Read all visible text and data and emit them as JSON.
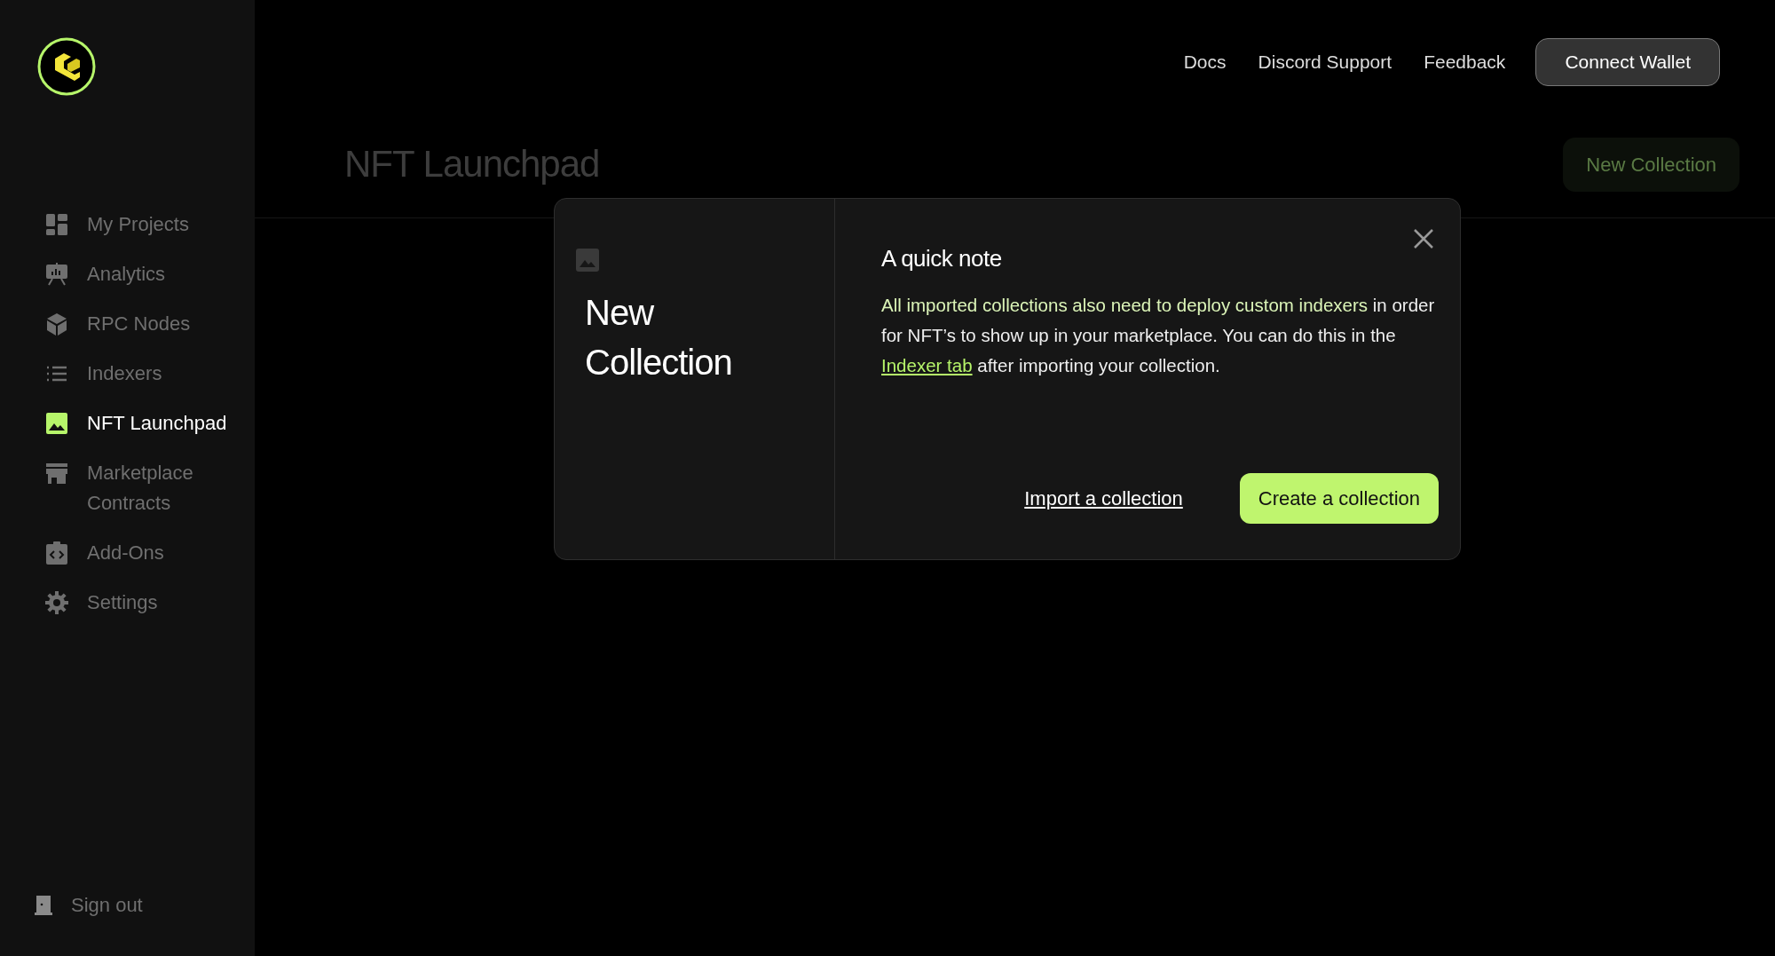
{
  "sidebar": {
    "items": [
      {
        "label": "My Projects",
        "selected": false
      },
      {
        "label": "Analytics",
        "selected": false
      },
      {
        "label": "RPC Nodes",
        "selected": false
      },
      {
        "label": "Indexers",
        "selected": false
      },
      {
        "label": "NFT Launchpad",
        "selected": true
      },
      {
        "label": "Marketplace Contracts",
        "selected": false
      },
      {
        "label": "Add-Ons",
        "selected": false
      },
      {
        "label": "Settings",
        "selected": false
      }
    ],
    "sign_out": "Sign out"
  },
  "top_nav": {
    "links": [
      "Docs",
      "Discord Support",
      "Feedback"
    ],
    "connect_button": "Connect Wallet"
  },
  "page": {
    "title": "NFT Launchpad",
    "new_button": "New Collection"
  },
  "modal": {
    "side_title": "New Collection",
    "heading": "A quick note",
    "text_before_link": "**All imported collections also need to deploy custom indexers** in order for NFT’s to show up in your marketplace. You can do this in the ",
    "link": "Indexer tab",
    "text_after_link": " after importing your collection.",
    "secondary_action": "Import a collection",
    "primary_action": "Create a collection"
  }
}
